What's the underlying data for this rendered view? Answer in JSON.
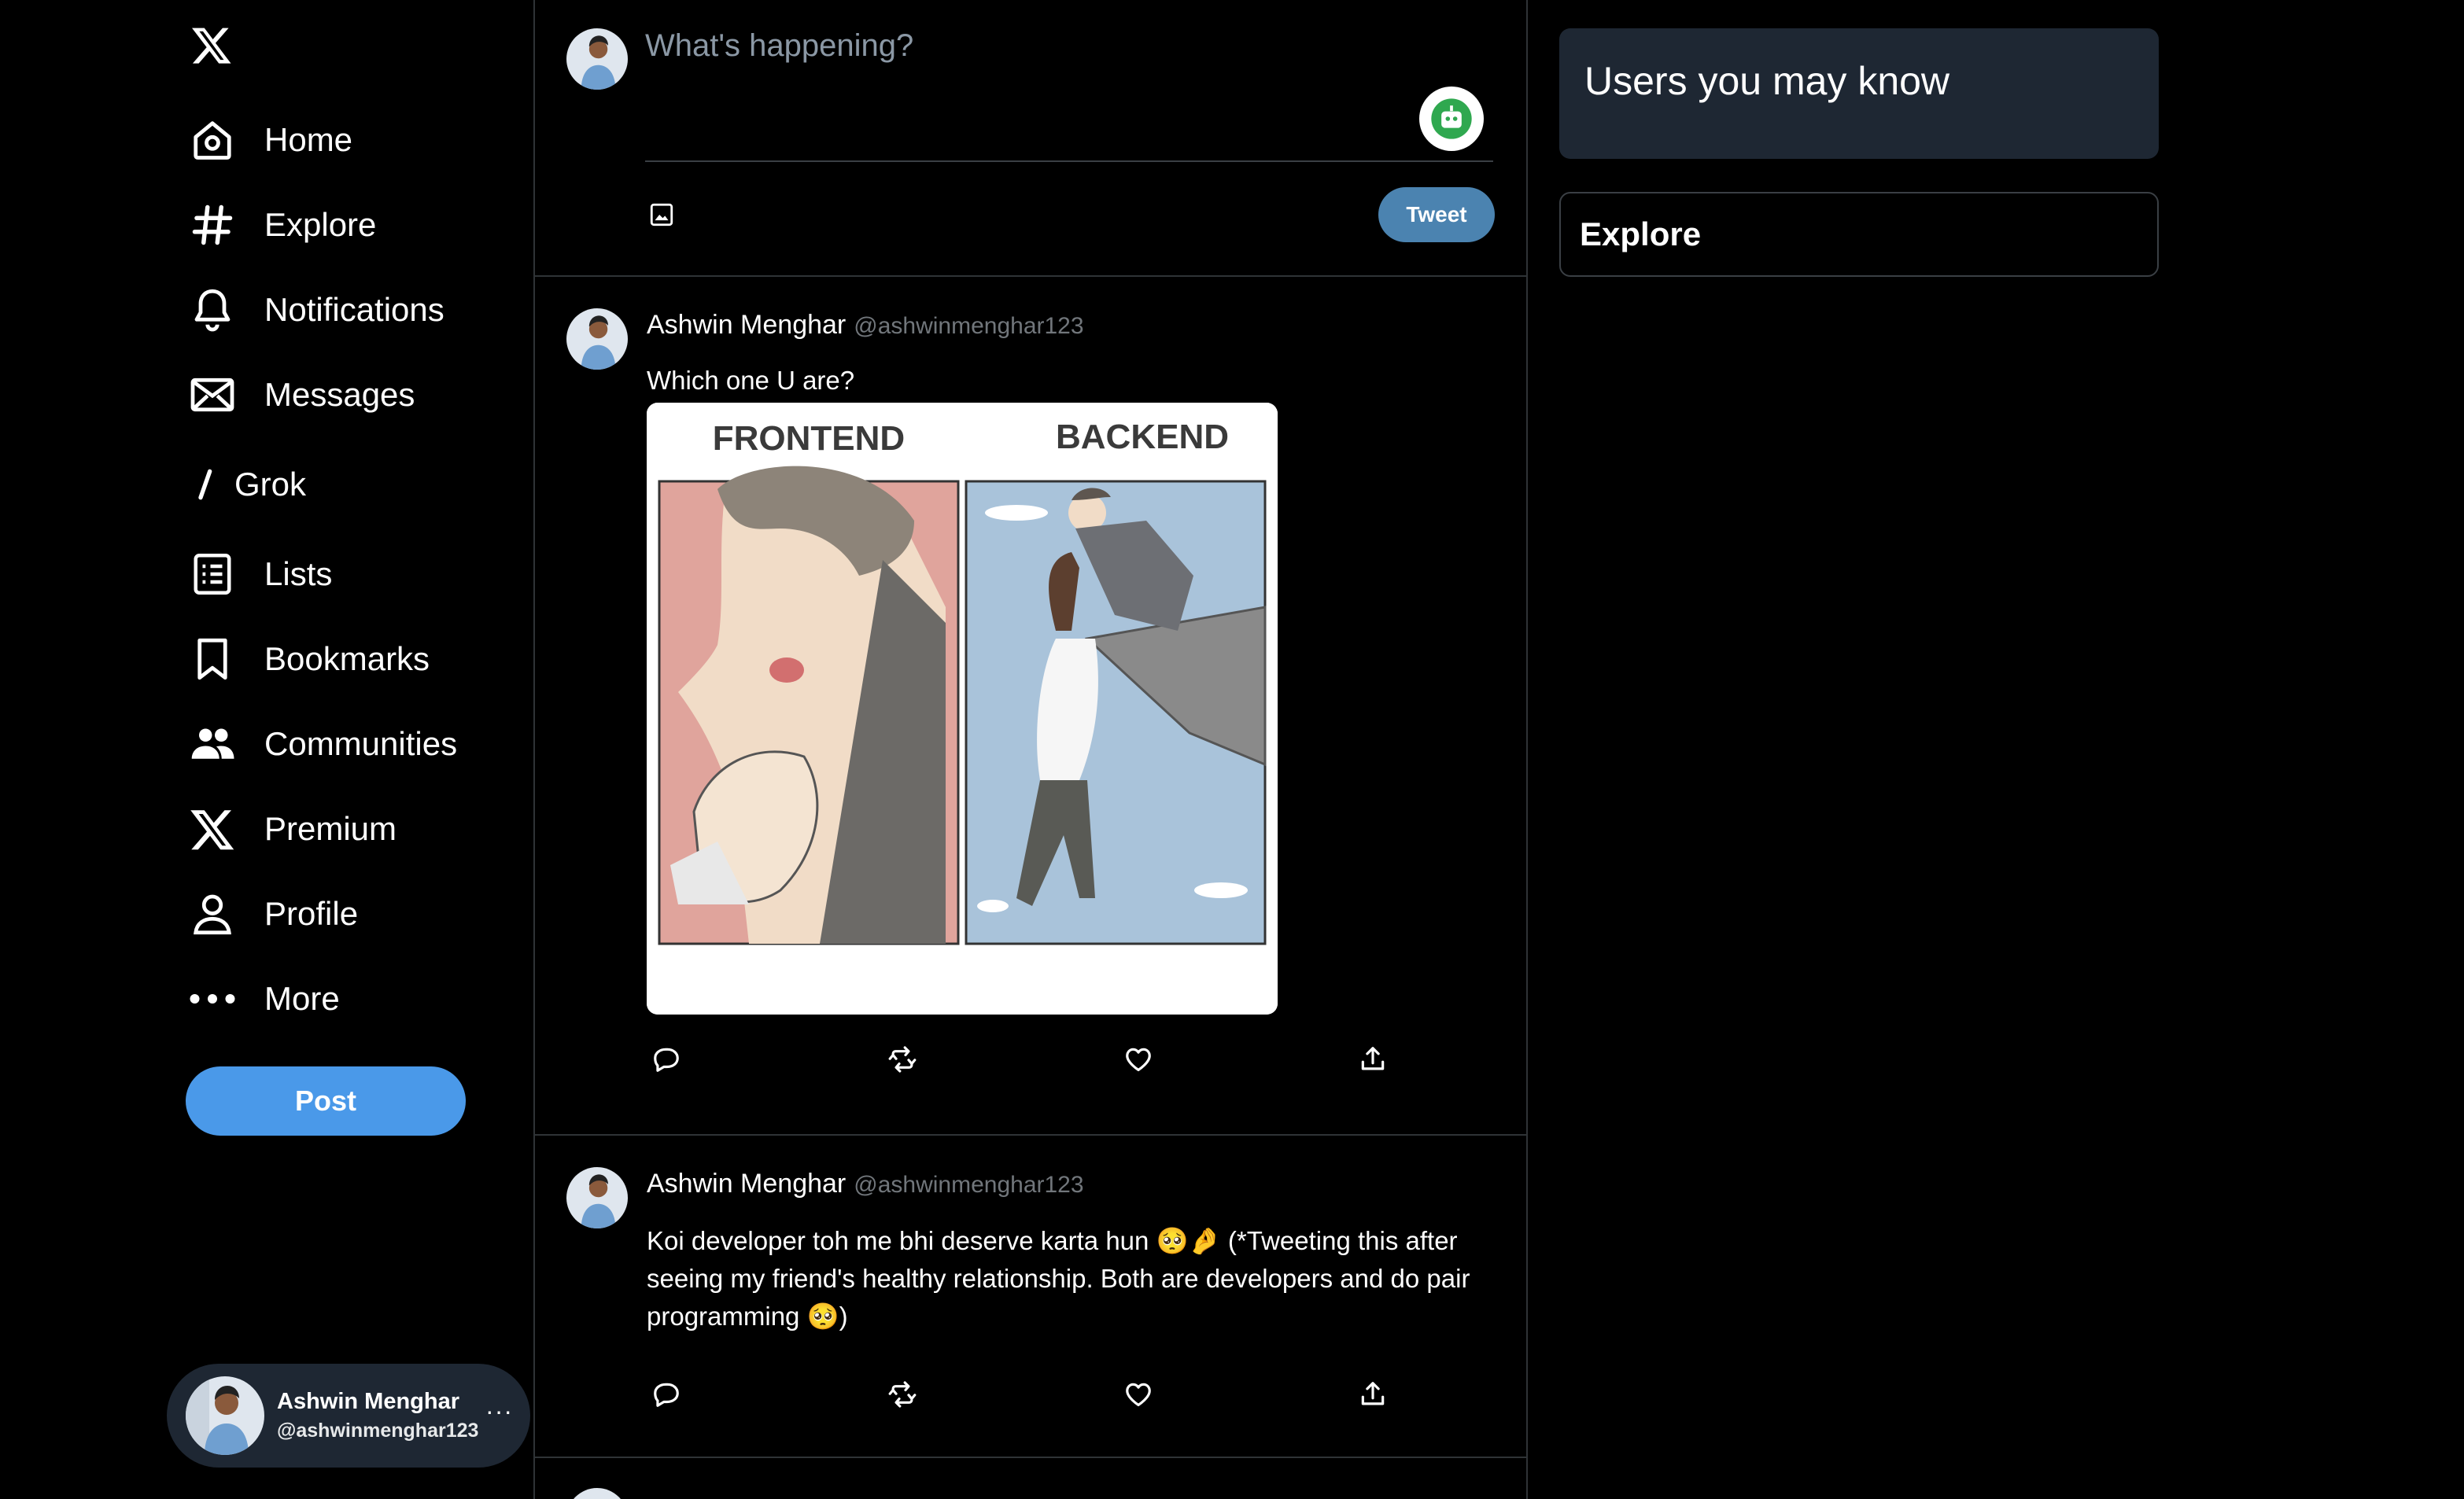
{
  "nav": {
    "items": [
      {
        "label": "Home",
        "icon": "home-icon"
      },
      {
        "label": "Explore",
        "icon": "hashtag-icon"
      },
      {
        "label": "Notifications",
        "icon": "bell-icon"
      },
      {
        "label": "Messages",
        "icon": "envelope-icon"
      },
      {
        "label": "Grok",
        "icon": "grok-icon"
      },
      {
        "label": "Lists",
        "icon": "list-icon"
      },
      {
        "label": "Bookmarks",
        "icon": "bookmark-icon"
      },
      {
        "label": "Communities",
        "icon": "people-icon"
      },
      {
        "label": "Premium",
        "icon": "x-logo-icon"
      },
      {
        "label": "Profile",
        "icon": "person-icon"
      },
      {
        "label": "More",
        "icon": "more-dots-icon"
      }
    ],
    "post_label": "Post"
  },
  "account": {
    "name": "Ashwin Menghar",
    "handle": "@ashwinmenghar123",
    "menu": "···"
  },
  "composer": {
    "placeholder": "What's happening?",
    "tweet_label": "Tweet"
  },
  "tweets": [
    {
      "name": "Ashwin Menghar",
      "handle": "@ashwinmenghar123",
      "text": "Which one U are?",
      "media": {
        "left_label": "FRONTEND",
        "right_label": "BACKEND"
      }
    },
    {
      "name": "Ashwin Menghar",
      "handle": "@ashwinmenghar123",
      "text": "Koi developer toh me bhi deserve karta hun 🥺🤌 (*Tweeting this after seeing my friend's healthy relationship. Both are developers and do pair programming 🥺)"
    }
  ],
  "right": {
    "suggest_title": "Users you may know",
    "explore_title": "Explore"
  },
  "colors": {
    "accent": "#4a99e9",
    "tweet_button": "#4b83b0",
    "panel": "#1e2733",
    "border": "#2f3336",
    "muted": "#71767b"
  }
}
